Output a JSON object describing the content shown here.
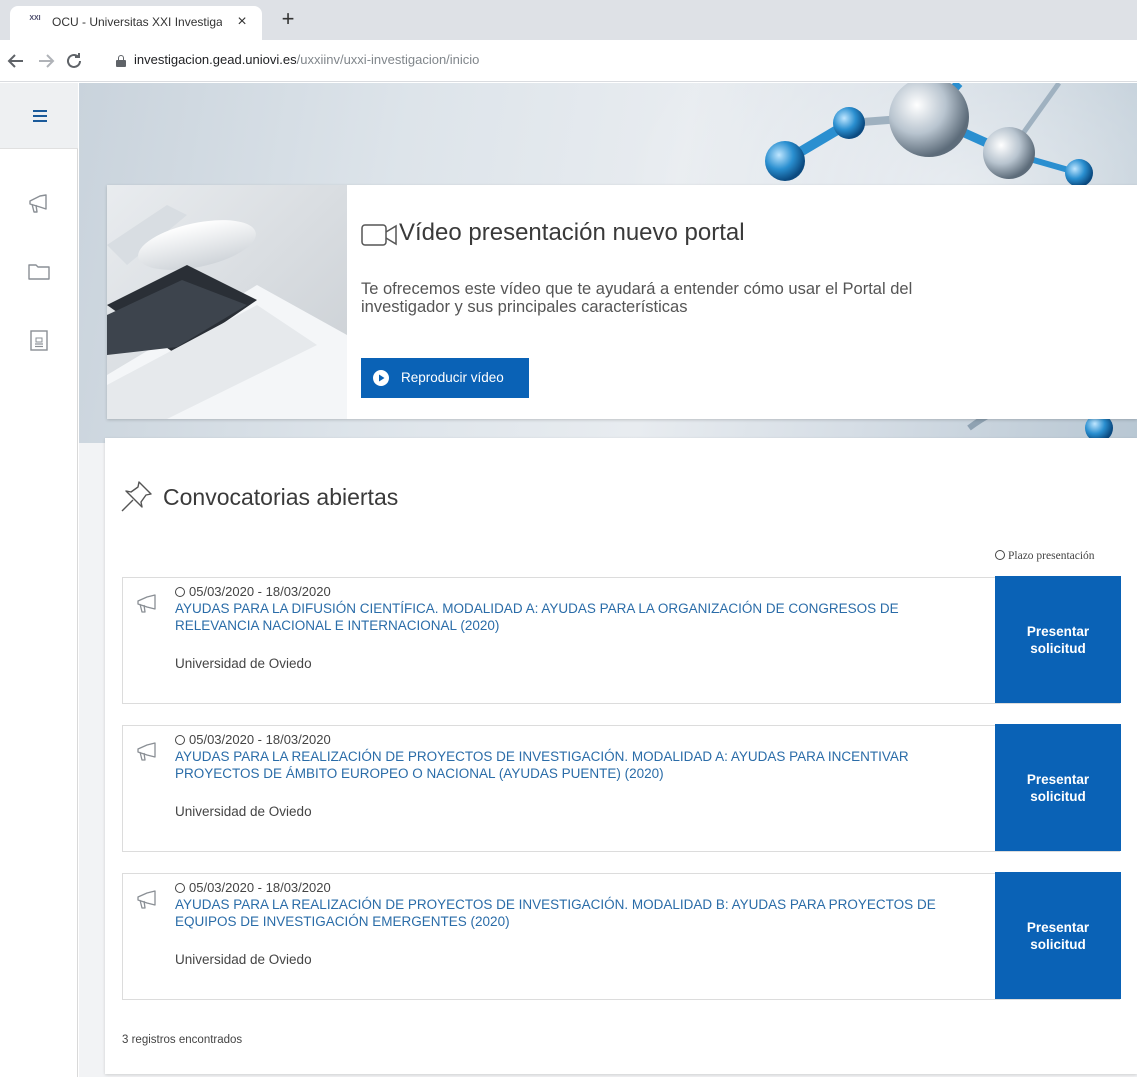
{
  "browser": {
    "tab_title": "OCU - Universitas XXI Investigac",
    "tab_favicon_text": "XXI",
    "close_glyph": "×",
    "new_tab_glyph": "+",
    "url_host": "investigacion.gead.uniovi.es",
    "url_path": "/uxxiinv/uxxi-investigacion/inicio"
  },
  "sidebar": {
    "items": [
      {
        "icon": "hamburger-menu-icon"
      },
      {
        "icon": "megaphone-icon"
      },
      {
        "icon": "folder-icon"
      },
      {
        "icon": "document-icon"
      }
    ]
  },
  "video": {
    "title": "Vídeo presentación nuevo portal",
    "description": "Te ofrecemos este vídeo que te ayudará a entender cómo usar el Portal del investigador y sus principales características",
    "button_label": "Reproducir vídeo"
  },
  "convocatorias": {
    "title": "Convocatorias abiertas",
    "plazo_label": "Plazo presentación",
    "items": [
      {
        "date": "05/03/2020 - 18/03/2020",
        "title": "AYUDAS PARA LA DIFUSIÓN CIENTÍFICA. MODALIDAD A: AYUDAS PARA LA ORGANIZACIÓN DE CONGRESOS DE RELEVANCIA NACIONAL E INTERNACIONAL (2020)",
        "org": "Universidad de Oviedo",
        "button_label": "Presentar solicitud"
      },
      {
        "date": "05/03/2020 - 18/03/2020",
        "title": "AYUDAS PARA LA REALIZACIÓN DE PROYECTOS DE INVESTIGACIÓN. MODALIDAD A: AYUDAS PARA INCENTIVAR PROYECTOS DE ÁMBITO EUROPEO O NACIONAL (AYUDAS PUENTE) (2020)",
        "org": "Universidad de Oviedo",
        "button_label": "Presentar solicitud"
      },
      {
        "date": "05/03/2020 - 18/03/2020",
        "title": "AYUDAS PARA LA REALIZACIÓN DE PROYECTOS DE INVESTIGACIÓN. MODALIDAD B: AYUDAS PARA PROYECTOS DE EQUIPOS DE INVESTIGACIÓN EMERGENTES (2020)",
        "org": "Universidad de Oviedo",
        "button_label": "Presentar solicitud"
      }
    ],
    "records_text": "3 registros encontrados"
  },
  "colors": {
    "primary": "#0a62b6",
    "link": "#2a6ca8",
    "sidebar_accent": "#1a5a9a"
  }
}
